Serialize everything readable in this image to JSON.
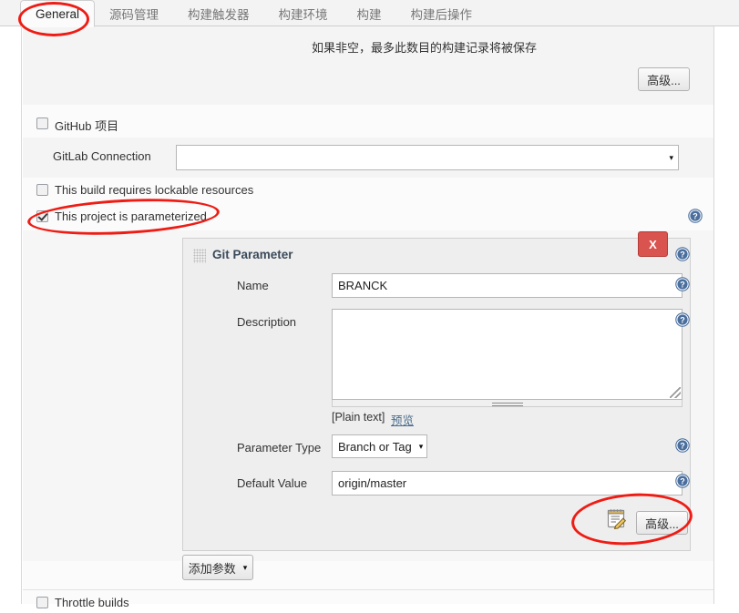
{
  "tabs": [
    {
      "label": "General",
      "active": true
    },
    {
      "label": "源码管理",
      "active": false
    },
    {
      "label": "构建触发器",
      "active": false
    },
    {
      "label": "构建环境",
      "active": false
    },
    {
      "label": "构建",
      "active": false
    },
    {
      "label": "构建后操作",
      "active": false
    }
  ],
  "discard": {
    "help_text": "如果非空，最多此数目的构建记录将被保存",
    "advanced_label": "高级..."
  },
  "options": {
    "github_project": {
      "label": "GitHub 项目",
      "checked": false
    },
    "gitlab_connection": {
      "label": "GitLab Connection",
      "value": "",
      "caret": "▾"
    },
    "lockable_resources": {
      "label": "This build requires lockable resources",
      "checked": false
    },
    "parameterized": {
      "label": "This project is parameterized",
      "checked": true
    }
  },
  "git_parameter": {
    "title": "Git Parameter",
    "delete_label": "X",
    "fields": {
      "name": {
        "label": "Name",
        "value": "BRANCK"
      },
      "description": {
        "label": "Description",
        "value": ""
      },
      "parameter_type": {
        "label": "Parameter Type",
        "value": "Branch or Tag",
        "caret": "▾"
      },
      "default_value": {
        "label": "Default Value",
        "value": "origin/master"
      }
    },
    "plain_text_note": "[Plain text]",
    "preview_link": "预览",
    "advanced_label": "高级..."
  },
  "add_parameter": {
    "label": "添加参数",
    "caret": "▾"
  },
  "throttle": {
    "label": "Throttle builds",
    "checked": false
  },
  "icons": {
    "help": "?",
    "editor": "editor-icon"
  },
  "colors": {
    "annotation_red": "#ee1c14",
    "delete_red": "#d9534f",
    "help_blue": "#4a6f9e",
    "panel_gray": "#eeeeee"
  }
}
